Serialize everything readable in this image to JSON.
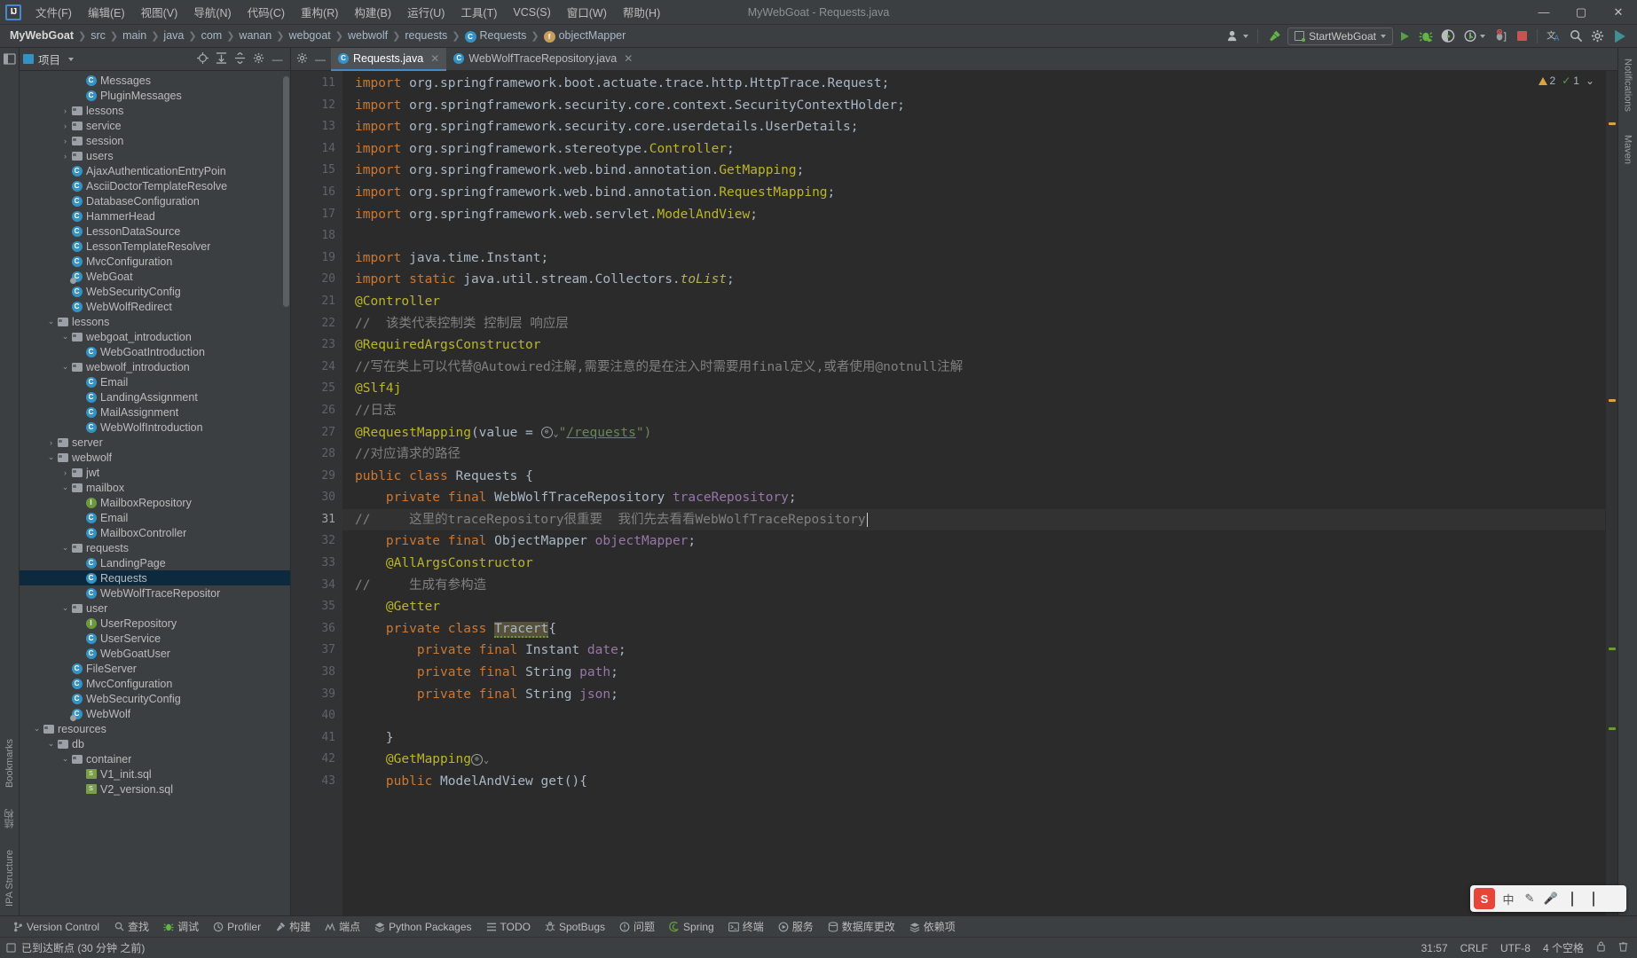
{
  "titlebar": {
    "logo": "IJ",
    "menus": [
      "文件(F)",
      "编辑(E)",
      "视图(V)",
      "导航(N)",
      "代码(C)",
      "重构(R)",
      "构建(B)",
      "运行(U)",
      "工具(T)",
      "VCS(S)",
      "窗口(W)",
      "帮助(H)"
    ],
    "window_title": "MyWebGoat - Requests.java",
    "minimize": "—",
    "maximize": "▢",
    "close": "✕"
  },
  "navbar": {
    "breadcrumbs": [
      {
        "label": "MyWebGoat",
        "icon": "none",
        "root": true
      },
      {
        "label": "src",
        "icon": "none"
      },
      {
        "label": "main",
        "icon": "none"
      },
      {
        "label": "java",
        "icon": "none"
      },
      {
        "label": "com",
        "icon": "none"
      },
      {
        "label": "wanan",
        "icon": "none"
      },
      {
        "label": "webgoat",
        "icon": "none"
      },
      {
        "label": "webwolf",
        "icon": "none"
      },
      {
        "label": "requests",
        "icon": "none"
      },
      {
        "label": "Requests",
        "icon": "class-icon"
      },
      {
        "label": "objectMapper",
        "icon": "field-icon"
      }
    ],
    "separator": "❯",
    "run_config": "StartWebGoat",
    "toolbar_icons": [
      "user-icon",
      "hammer-icon",
      "run-icon",
      "debug-icon",
      "coverage-icon",
      "profile-icon",
      "stop-icon",
      "translate-icon",
      "search-icon",
      "gear-icon",
      "updates-icon"
    ]
  },
  "left_strip": {
    "tabs": [
      "Bookmarks",
      "结构",
      "IPA Structure"
    ]
  },
  "right_strip": {
    "tabs": [
      "Notifications",
      "Maven"
    ]
  },
  "project": {
    "title": "项目",
    "tools": [
      "target-icon",
      "expand-icon",
      "collapse-icon",
      "gear-icon",
      "minimize-icon"
    ],
    "tree": [
      {
        "depth": 5,
        "arrow": "",
        "icon": "class-icon",
        "label": "Messages"
      },
      {
        "depth": 5,
        "arrow": "",
        "icon": "class-icon",
        "label": "PluginMessages"
      },
      {
        "depth": 4,
        "arrow": "›",
        "icon": "folder-icon",
        "label": "lessons"
      },
      {
        "depth": 4,
        "arrow": "›",
        "icon": "folder-icon",
        "label": "service"
      },
      {
        "depth": 4,
        "arrow": "›",
        "icon": "folder-icon",
        "label": "session"
      },
      {
        "depth": 4,
        "arrow": "›",
        "icon": "folder-icon",
        "label": "users"
      },
      {
        "depth": 4,
        "arrow": "",
        "icon": "class-icon",
        "label": "AjaxAuthenticationEntryPoin"
      },
      {
        "depth": 4,
        "arrow": "",
        "icon": "class-icon",
        "label": "AsciiDoctorTemplateResolve"
      },
      {
        "depth": 4,
        "arrow": "",
        "icon": "class-icon",
        "label": "DatabaseConfiguration"
      },
      {
        "depth": 4,
        "arrow": "",
        "icon": "class-icon",
        "label": "HammerHead"
      },
      {
        "depth": 4,
        "arrow": "",
        "icon": "class-icon",
        "label": "LessonDataSource"
      },
      {
        "depth": 4,
        "arrow": "",
        "icon": "class-icon",
        "label": "LessonTemplateResolver"
      },
      {
        "depth": 4,
        "arrow": "",
        "icon": "class-icon",
        "label": "MvcConfiguration"
      },
      {
        "depth": 4,
        "arrow": "",
        "icon": "class-run-icon",
        "label": "WebGoat"
      },
      {
        "depth": 4,
        "arrow": "",
        "icon": "class-icon",
        "label": "WebSecurityConfig"
      },
      {
        "depth": 4,
        "arrow": "",
        "icon": "class-icon",
        "label": "WebWolfRedirect"
      },
      {
        "depth": 3,
        "arrow": "⌄",
        "icon": "folder-icon",
        "label": "lessons"
      },
      {
        "depth": 4,
        "arrow": "⌄",
        "icon": "folder-icon",
        "label": "webgoat_introduction"
      },
      {
        "depth": 5,
        "arrow": "",
        "icon": "class-icon",
        "label": "WebGoatIntroduction"
      },
      {
        "depth": 4,
        "arrow": "⌄",
        "icon": "folder-icon",
        "label": "webwolf_introduction"
      },
      {
        "depth": 5,
        "arrow": "",
        "icon": "class-icon",
        "label": "Email"
      },
      {
        "depth": 5,
        "arrow": "",
        "icon": "class-icon",
        "label": "LandingAssignment"
      },
      {
        "depth": 5,
        "arrow": "",
        "icon": "class-icon",
        "label": "MailAssignment"
      },
      {
        "depth": 5,
        "arrow": "",
        "icon": "class-icon",
        "label": "WebWolfIntroduction"
      },
      {
        "depth": 3,
        "arrow": "›",
        "icon": "folder-icon",
        "label": "server"
      },
      {
        "depth": 3,
        "arrow": "⌄",
        "icon": "folder-icon",
        "label": "webwolf"
      },
      {
        "depth": 4,
        "arrow": "›",
        "icon": "folder-icon",
        "label": "jwt"
      },
      {
        "depth": 4,
        "arrow": "⌄",
        "icon": "folder-icon",
        "label": "mailbox"
      },
      {
        "depth": 5,
        "arrow": "",
        "icon": "interface-icon",
        "label": "MailboxRepository"
      },
      {
        "depth": 5,
        "arrow": "",
        "icon": "class-icon",
        "label": "Email"
      },
      {
        "depth": 5,
        "arrow": "",
        "icon": "class-icon",
        "label": "MailboxController"
      },
      {
        "depth": 4,
        "arrow": "⌄",
        "icon": "folder-icon",
        "label": "requests"
      },
      {
        "depth": 5,
        "arrow": "",
        "icon": "class-icon",
        "label": "LandingPage"
      },
      {
        "depth": 5,
        "arrow": "",
        "icon": "class-icon",
        "label": "Requests",
        "selected": true
      },
      {
        "depth": 5,
        "arrow": "",
        "icon": "class-icon",
        "label": "WebWolfTraceRepositor"
      },
      {
        "depth": 4,
        "arrow": "⌄",
        "icon": "folder-icon",
        "label": "user"
      },
      {
        "depth": 5,
        "arrow": "",
        "icon": "interface-icon",
        "label": "UserRepository"
      },
      {
        "depth": 5,
        "arrow": "",
        "icon": "class-icon",
        "label": "UserService"
      },
      {
        "depth": 5,
        "arrow": "",
        "icon": "class-icon",
        "label": "WebGoatUser"
      },
      {
        "depth": 4,
        "arrow": "",
        "icon": "class-icon",
        "label": "FileServer"
      },
      {
        "depth": 4,
        "arrow": "",
        "icon": "class-icon",
        "label": "MvcConfiguration"
      },
      {
        "depth": 4,
        "arrow": "",
        "icon": "class-icon",
        "label": "WebSecurityConfig"
      },
      {
        "depth": 4,
        "arrow": "",
        "icon": "class-run-icon",
        "label": "WebWolf"
      },
      {
        "depth": 2,
        "arrow": "⌄",
        "icon": "folder-icon",
        "label": "resources"
      },
      {
        "depth": 3,
        "arrow": "⌄",
        "icon": "folder-icon",
        "label": "db"
      },
      {
        "depth": 4,
        "arrow": "⌄",
        "icon": "folder-icon",
        "label": "container"
      },
      {
        "depth": 5,
        "arrow": "",
        "icon": "sql-icon",
        "label": "V1_init.sql"
      },
      {
        "depth": 5,
        "arrow": "",
        "icon": "sql-icon",
        "label": "V2_version.sql"
      }
    ]
  },
  "editor": {
    "tabs": [
      {
        "label": "Requests.java",
        "icon": "class-icon",
        "active": true,
        "close": "✕"
      },
      {
        "label": "WebWolfTraceRepository.java",
        "icon": "class-icon",
        "active": false,
        "close": "✕"
      }
    ],
    "tab_tools": [
      "gear-icon",
      "minimize-icon"
    ],
    "inspections": {
      "warning_count": "2",
      "check_count": "1",
      "warning_icon": "warning-triangle-icon",
      "check_icon": "checkmark-icon",
      "chevron": "⌄"
    },
    "first_line_number": 11,
    "current_line": 31,
    "lines": [
      {
        "n": 11,
        "tokens": [
          {
            "t": "import ",
            "c": "kw"
          },
          {
            "t": "org.springframework.boot.actuate.trace.http.HttpTrace.Request;",
            "c": "plain"
          }
        ]
      },
      {
        "n": 12,
        "tokens": [
          {
            "t": "import ",
            "c": "kw"
          },
          {
            "t": "org.springframework.security.core.context.SecurityContextHolder;",
            "c": "plain"
          }
        ]
      },
      {
        "n": 13,
        "tokens": [
          {
            "t": "import ",
            "c": "kw"
          },
          {
            "t": "org.springframework.security.core.userdetails.UserDetails;",
            "c": "plain"
          }
        ]
      },
      {
        "n": 14,
        "tokens": [
          {
            "t": "import ",
            "c": "kw"
          },
          {
            "t": "org.springframework.stereotype.",
            "c": "plain"
          },
          {
            "t": "Controller",
            "c": "ann"
          },
          {
            "t": ";",
            "c": "plain"
          }
        ]
      },
      {
        "n": 15,
        "tokens": [
          {
            "t": "import ",
            "c": "kw"
          },
          {
            "t": "org.springframework.web.bind.annotation.",
            "c": "plain"
          },
          {
            "t": "GetMapping",
            "c": "ann"
          },
          {
            "t": ";",
            "c": "plain"
          }
        ]
      },
      {
        "n": 16,
        "tokens": [
          {
            "t": "import ",
            "c": "kw"
          },
          {
            "t": "org.springframework.web.bind.annotation.",
            "c": "plain"
          },
          {
            "t": "RequestMapping",
            "c": "ann"
          },
          {
            "t": ";",
            "c": "plain"
          }
        ]
      },
      {
        "n": 17,
        "tokens": [
          {
            "t": "import ",
            "c": "kw"
          },
          {
            "t": "org.springframework.web.servlet.",
            "c": "plain"
          },
          {
            "t": "ModelAndView",
            "c": "ann"
          },
          {
            "t": ";",
            "c": "plain"
          }
        ]
      },
      {
        "n": 18,
        "tokens": []
      },
      {
        "n": 19,
        "tokens": [
          {
            "t": "import ",
            "c": "kw"
          },
          {
            "t": "java.time.Instant;",
            "c": "plain"
          }
        ]
      },
      {
        "n": 20,
        "tokens": [
          {
            "t": "import static ",
            "c": "kw"
          },
          {
            "t": "java.util.stream.Collectors.",
            "c": "plain"
          },
          {
            "t": "toList",
            "c": "sfld"
          },
          {
            "t": ";",
            "c": "plain"
          }
        ]
      },
      {
        "n": 21,
        "tokens": [
          {
            "t": "@Controller",
            "c": "ann"
          }
        ]
      },
      {
        "n": 22,
        "tokens": [
          {
            "t": "//  该类代表控制类 控制层 响应层",
            "c": "cmt"
          }
        ]
      },
      {
        "n": 23,
        "tokens": [
          {
            "t": "@RequiredArgsConstructor",
            "c": "ann"
          }
        ]
      },
      {
        "n": 24,
        "tokens": [
          {
            "t": "//写在类上可以代替@Autowired注解,需要注意的是在注入时需要用final定义,或者使用@notnull注解",
            "c": "cmt"
          }
        ]
      },
      {
        "n": 25,
        "tokens": [
          {
            "t": "@Slf4j",
            "c": "ann"
          }
        ]
      },
      {
        "n": 26,
        "tokens": [
          {
            "t": "//日志",
            "c": "cmt"
          }
        ]
      },
      {
        "n": 27,
        "tokens": [
          {
            "t": "@RequestMapping",
            "c": "ann"
          },
          {
            "t": "(value = ",
            "c": "plain"
          },
          {
            "t": "GLOBE",
            "c": "globe"
          },
          {
            "t": "\"",
            "c": "str"
          },
          {
            "t": "/requests",
            "c": "urlstr"
          },
          {
            "t": "\")",
            "c": "str"
          }
        ]
      },
      {
        "n": 28,
        "tokens": [
          {
            "t": "//对应请求的路径",
            "c": "cmt"
          }
        ]
      },
      {
        "n": 29,
        "tokens": [
          {
            "t": "public class ",
            "c": "kw"
          },
          {
            "t": "Requests ",
            "c": "cls"
          },
          {
            "t": "{",
            "c": "plain"
          }
        ]
      },
      {
        "n": 30,
        "tokens": [
          {
            "t": "    private final ",
            "c": "kw"
          },
          {
            "t": "WebWolfTraceRepository ",
            "c": "cls"
          },
          {
            "t": "traceRepository",
            "c": "fld"
          },
          {
            "t": ";",
            "c": "plain"
          }
        ]
      },
      {
        "n": 31,
        "tokens": [
          {
            "t": "//     这里的traceRepository很重要  我们先去看看WebWolfTraceRepository",
            "c": "cmt"
          },
          {
            "t": "CARET",
            "c": "caret"
          }
        ],
        "highlight": true
      },
      {
        "n": 32,
        "tokens": [
          {
            "t": "    private final ",
            "c": "kw"
          },
          {
            "t": "ObjectMapper ",
            "c": "cls"
          },
          {
            "t": "objectMapper",
            "c": "fld"
          },
          {
            "t": ";",
            "c": "plain"
          }
        ]
      },
      {
        "n": 33,
        "tokens": [
          {
            "t": "    ",
            "c": "plain"
          },
          {
            "t": "@AllArgsConstructor",
            "c": "ann"
          }
        ]
      },
      {
        "n": 34,
        "tokens": [
          {
            "t": "//     生成有参构造",
            "c": "cmt"
          }
        ]
      },
      {
        "n": 35,
        "tokens": [
          {
            "t": "    ",
            "c": "plain"
          },
          {
            "t": "@Getter",
            "c": "ann"
          }
        ]
      },
      {
        "n": 36,
        "tokens": [
          {
            "t": "    private class ",
            "c": "kw"
          },
          {
            "t": "Tracert",
            "c": "tracert"
          },
          {
            "t": "{",
            "c": "plain"
          }
        ]
      },
      {
        "n": 37,
        "tokens": [
          {
            "t": "        private final ",
            "c": "kw"
          },
          {
            "t": "Instant ",
            "c": "cls"
          },
          {
            "t": "date",
            "c": "fld"
          },
          {
            "t": ";",
            "c": "plain"
          }
        ]
      },
      {
        "n": 38,
        "tokens": [
          {
            "t": "        private final ",
            "c": "kw"
          },
          {
            "t": "String ",
            "c": "cls"
          },
          {
            "t": "path",
            "c": "fld"
          },
          {
            "t": ";",
            "c": "plain"
          }
        ]
      },
      {
        "n": 39,
        "tokens": [
          {
            "t": "        private final ",
            "c": "kw"
          },
          {
            "t": "String ",
            "c": "cls"
          },
          {
            "t": "json",
            "c": "fld"
          },
          {
            "t": ";",
            "c": "plain"
          }
        ]
      },
      {
        "n": 40,
        "tokens": []
      },
      {
        "n": 41,
        "tokens": [
          {
            "t": "    }",
            "c": "plain"
          }
        ]
      },
      {
        "n": 42,
        "tokens": [
          {
            "t": "    ",
            "c": "plain"
          },
          {
            "t": "@GetMapping",
            "c": "ann"
          },
          {
            "t": "GLOBE2",
            "c": "globe"
          }
        ]
      },
      {
        "n": 43,
        "tokens": [
          {
            "t": "    public ",
            "c": "kw"
          },
          {
            "t": "ModelAndView ",
            "c": "cls"
          },
          {
            "t": "get",
            "c": "plain"
          },
          {
            "t": "(){",
            "c": "plain"
          }
        ]
      }
    ]
  },
  "bottombar": {
    "items": [
      {
        "label": "Version Control",
        "icon": "branch-icon"
      },
      {
        "label": "查找",
        "icon": "search-icon"
      },
      {
        "label": "调试",
        "icon": "debug-icon"
      },
      {
        "label": "Profiler",
        "icon": "profiler-icon"
      },
      {
        "label": "构建",
        "icon": "hammer-icon"
      },
      {
        "label": "端点",
        "icon": "endpoints-icon"
      },
      {
        "label": "Python Packages",
        "icon": "python-icon"
      },
      {
        "label": "TODO",
        "icon": "todo-icon"
      },
      {
        "label": "SpotBugs",
        "icon": "bug-icon"
      },
      {
        "label": "问题",
        "icon": "problems-icon"
      },
      {
        "label": "Spring",
        "icon": "spring-icon"
      },
      {
        "label": "终端",
        "icon": "terminal-icon"
      },
      {
        "label": "服务",
        "icon": "services-icon"
      },
      {
        "label": "数据库更改",
        "icon": "database-icon"
      },
      {
        "label": "依赖项",
        "icon": "dependencies-icon"
      }
    ]
  },
  "statusbar": {
    "message": "已到达断点 (30 分钟 之前)",
    "message_icon": "breakpoint-icon",
    "caret_position": "31:57",
    "line_separator": "CRLF",
    "encoding": "UTF-8",
    "indent": "4 个空格",
    "lock_icon": "lock-icon",
    "trash_icon": "trash-icon"
  },
  "ime": {
    "logo": "S",
    "lang": "中",
    "items": [
      "中",
      "✎",
      "🎤",
      "⌨",
      "▤",
      "▦"
    ]
  },
  "colors": {
    "accent": "#4a88c7",
    "selection": "#0d293e",
    "editor_bg": "#2b2b2b",
    "panel_bg": "#3c3f41",
    "keyword": "#cc7832",
    "string": "#6a8759",
    "annotation": "#bbb529",
    "comment": "#808080",
    "field": "#9876aa",
    "run_green": "#5a9e49",
    "stop_red": "#c75450"
  }
}
